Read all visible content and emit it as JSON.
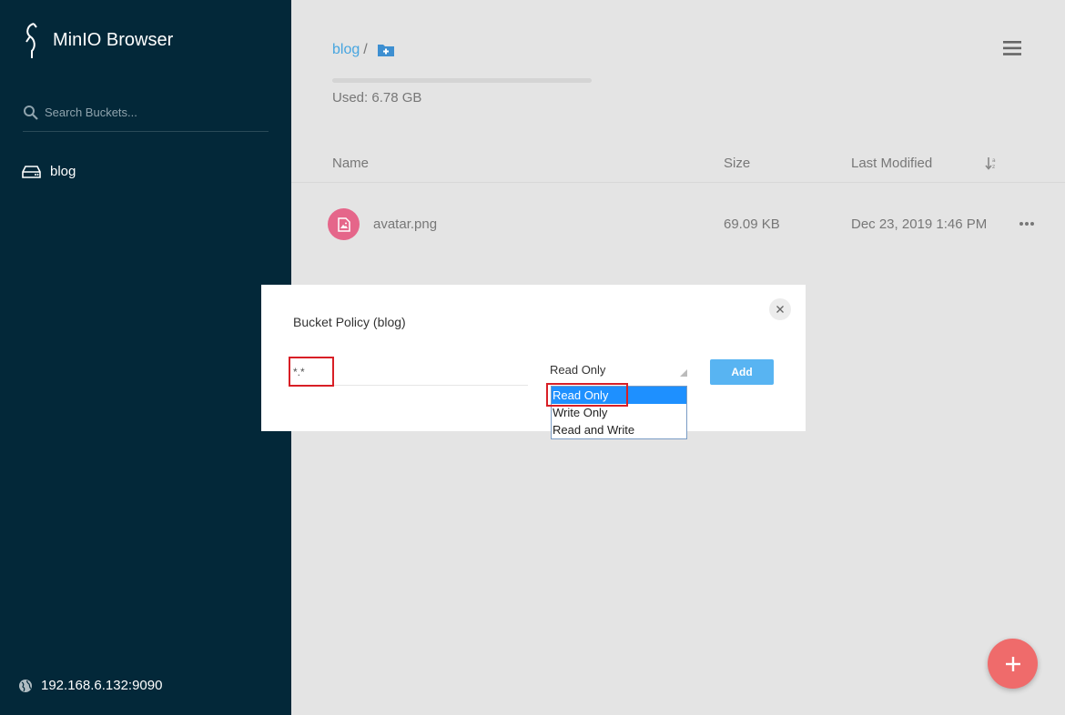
{
  "sidebar": {
    "app_title": "MinIO Browser",
    "search_placeholder": "Search Buckets...",
    "buckets": [
      {
        "label": "blog"
      }
    ],
    "host": "192.168.6.132:9090"
  },
  "main": {
    "breadcrumb": {
      "bucket": "blog",
      "separator": "/"
    },
    "usage_text": "Used: 6.78 GB",
    "table": {
      "headers": {
        "name": "Name",
        "size": "Size",
        "last_modified": "Last Modified"
      },
      "rows": [
        {
          "name": "avatar.png",
          "size": "69.09 KB",
          "modified": "Dec 23, 2019 1:46 PM"
        }
      ]
    }
  },
  "modal": {
    "title": "Bucket Policy (blog)",
    "prefix_value": "*.*",
    "selected_policy": "Read Only",
    "add_label": "Add",
    "options": [
      "Read Only",
      "Write Only",
      "Read and Write"
    ]
  },
  "colors": {
    "sidebar_bg": "#032839",
    "accent_link": "#46a5e0",
    "file_icon": "#e5668a",
    "fab": "#ef6b6b",
    "add_button": "#58b4f2",
    "highlight_box": "#d81f26"
  },
  "icons": [
    "logo-icon",
    "search-icon",
    "bucket-drive-icon",
    "globe-icon",
    "add-folder-icon",
    "hamburger-menu-icon",
    "sort-icon",
    "image-file-icon",
    "more-icon",
    "close-icon",
    "plus-icon",
    "select-arrow-icon"
  ]
}
